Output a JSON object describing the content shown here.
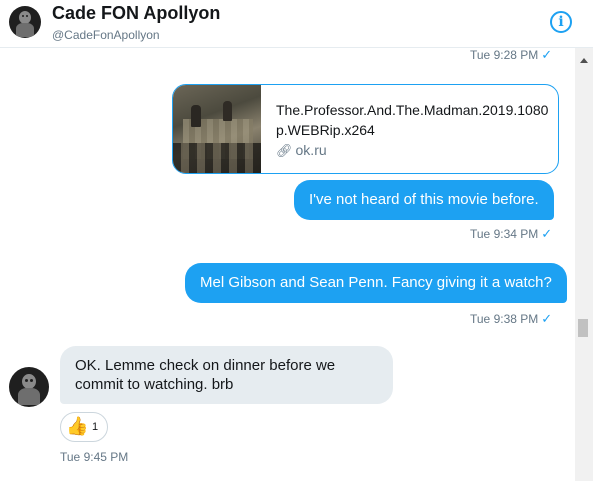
{
  "header": {
    "name": "Cade FON Apollyon",
    "handle": "@CadeFonApollyon",
    "info_icon": "i"
  },
  "messages": {
    "ts1": "Tue 9:28 PM",
    "card": {
      "title": "The.Professor.And.The.Madman.2019.1080p.WEBRip.x264",
      "link": "ok.ru"
    },
    "out1": "I've not heard of this movie before.",
    "ts2": "Tue 9:34 PM",
    "out2": "Mel Gibson and Sean Penn. Fancy giving it a watch?",
    "ts3": "Tue 9:38 PM",
    "in1": "OK. Lemme check on dinner before we commit to watching. brb",
    "reaction": {
      "emoji": "👍",
      "count": "1"
    },
    "ts4": "Tue 9:45 PM"
  },
  "icons": {
    "check": "✓",
    "link": "🔗"
  },
  "colors": {
    "accent": "#1da1f2",
    "incoming_bubble": "#e6ecf0",
    "muted_text": "#657786"
  }
}
